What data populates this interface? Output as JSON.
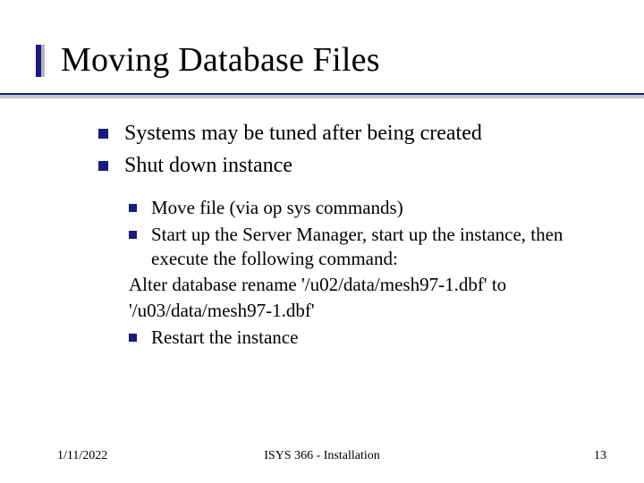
{
  "title": "Moving Database Files",
  "bullets_l1": [
    "Systems may be tuned after being created",
    "Shut down instance"
  ],
  "sub": {
    "b1": "Move file (via op sys commands)",
    "b2": "Start up the Server Manager, start up the instance, then execute the following command:",
    "plain1": "Alter database rename '/u02/data/mesh97-1.dbf' to",
    "plain2": "'/u03/data/mesh97-1.dbf'",
    "b3": "Restart the instance"
  },
  "footer": {
    "date": "1/11/2022",
    "course": "ISYS 366 - Installation",
    "page": "13"
  }
}
